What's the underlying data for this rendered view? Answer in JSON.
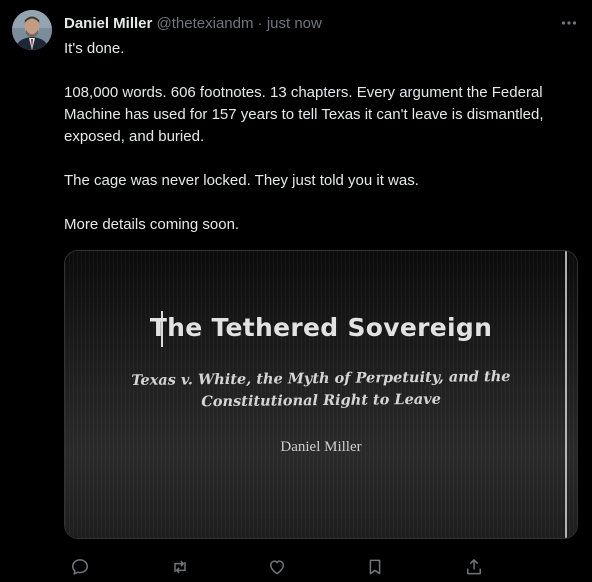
{
  "post": {
    "author_name": "Daniel Miller",
    "handle": "@thetexiandm",
    "separator": "·",
    "timestamp": "just now",
    "text": [
      "It's done.",
      "108,000 words. 606 footnotes. 13 chapters. Every argument the Federal Machine has used for 157 years to tell Texas it can't leave is dismantled, exposed, and buried.",
      "The cage was never locked. They just told you it was.",
      "More details coming soon."
    ]
  },
  "media": {
    "title": "The Tethered Sovereign",
    "subtitle_line1": "Texas v. White, the Myth of Perpetuity, and the",
    "subtitle_line2": "Constitutional Right to Leave",
    "author": "Daniel Miller"
  },
  "actions": {
    "reply_icon": "reply-icon",
    "repost_icon": "repost-icon",
    "like_icon": "heart-icon",
    "bookmark_icon": "bookmark-icon",
    "share_icon": "share-icon",
    "more_icon": "more-icon"
  },
  "colors": {
    "background": "#000000",
    "text": "#e7e9ea",
    "muted": "#71767b",
    "border": "#2f3336"
  }
}
